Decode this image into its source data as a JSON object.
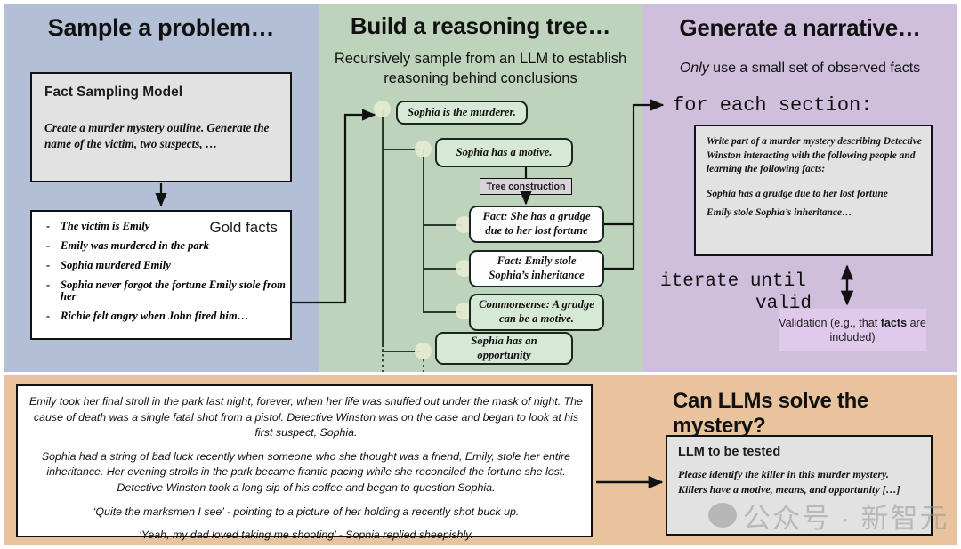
{
  "columns": {
    "sample": {
      "title": "Sample a problem…",
      "fact_sampling": {
        "title": "Fact Sampling Model",
        "prompt": "Create a murder mystery outline.  Generate the name of the victim, two suspects, …"
      },
      "gold_facts": {
        "label": "Gold facts",
        "bullet": "-",
        "items": [
          "The victim is Emily",
          "Emily was murdered in the park",
          "Sophia murdered Emily",
          "Sophia never forgot the fortune Emily stole from her",
          "Richie felt angry when John fired him…"
        ]
      }
    },
    "tree": {
      "title": "Build a reasoning tree…",
      "subtitle": "Recursively sample from an LLM to establish reasoning behind conclusions",
      "badge": "Tree construction",
      "nodes": [
        {
          "id": "murderer",
          "lead": "",
          "text": "Sophia is the murderer."
        },
        {
          "id": "motive",
          "lead": "",
          "text": "Sophia has a motive."
        },
        {
          "id": "fact1",
          "lead": "Fact:",
          "text": " She has a grudge due to her lost fortune"
        },
        {
          "id": "fact2",
          "lead": "Fact:",
          "text": " Emily stole Sophia’s inheritance"
        },
        {
          "id": "commonsense",
          "lead": "Commonsense:",
          "text": " A grudge can be a motive."
        },
        {
          "id": "opportunity",
          "lead": "",
          "text": "Sophia has an opportunity"
        }
      ]
    },
    "narrative": {
      "title": "Generate a narrative…",
      "subtitle_em": "Only",
      "subtitle_rest": " use a small set of observed facts",
      "for_each": "for each section:",
      "prompt_p1": "Write part of a murder mystery describing Detective Winston interacting with the following people and learning the following facts:",
      "prompt_p2": "Sophia has a grudge due to her lost fortune",
      "prompt_p3": "Emily stole Sophia’s inheritance…",
      "iterate_line1": "iterate until",
      "iterate_line2": "valid",
      "validation_pre": "Validation (e.g., that ",
      "validation_bold": "facts",
      "validation_post": " are included)"
    }
  },
  "bottom": {
    "title": "Can LLMs solve the mystery?",
    "narrative_paragraphs": [
      "Emily took her final stroll in the park last night, forever, when her life was snuffed out under the mask of night.  The cause of death was a single fatal shot from a pistol.  Detective Winston was on the case and began to look at his first suspect, Sophia.",
      "Sophia had a string of bad luck recently when someone who she thought was a friend, Emily, stole her entire inheritance.  Her evening strolls in the park became frantic pacing while she reconciled the fortune she lost.  Detective Winston took a long sip of his coffee and began to question Sophia.",
      "‘Quite the marksmen I see’ - pointing to a picture of her holding a recently shot buck up.",
      "‘Yeah, my dad loved taking me shooting’ - Sophia replied sheepishly."
    ],
    "llm_box": {
      "title": "LLM to be tested",
      "prompt": "Please identify the killer in this murder mystery. Killers have a motive, means, and opportunity […]"
    }
  },
  "watermark": {
    "text": "公众号 · 新智元"
  },
  "colors": {
    "panel_sample": "#b2bfd7",
    "panel_tree": "#bdd3bc",
    "panel_narrative": "#cfbedc",
    "panel_bottom": "#e8c39e",
    "node_fill": "#d6e8d6",
    "node_fill_white": "#fdfdfd",
    "dot": "#e4eccf",
    "box_gray": "#e2e2e2",
    "validation_fill": "#e0caec",
    "stroke": "#111111"
  }
}
